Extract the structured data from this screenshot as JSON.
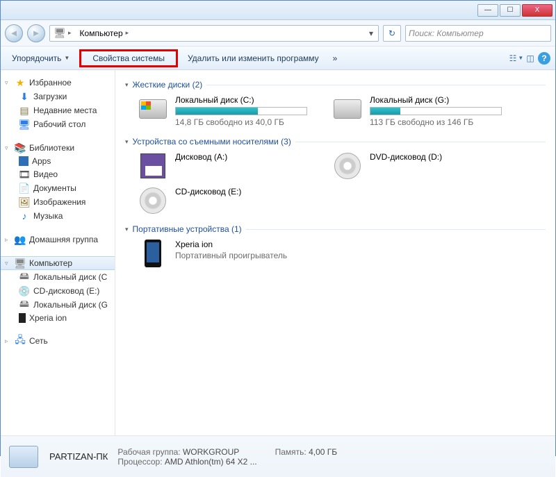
{
  "titlebar": {
    "min": "—",
    "max": "☐",
    "close": "X"
  },
  "nav": {
    "computer": "Компьютер",
    "search_placeholder": "Поиск: Компьютер"
  },
  "toolbar": {
    "organize": "Упорядочить",
    "sys_props": "Свойства системы",
    "uninstall": "Удалить или изменить программу",
    "more": "»"
  },
  "sidebar": {
    "favorites": {
      "head": "Избранное",
      "items": [
        "Загрузки",
        "Недавние места",
        "Рабочий стол"
      ]
    },
    "libraries": {
      "head": "Библиотеки",
      "items": [
        "Apps",
        "Видео",
        "Документы",
        "Изображения",
        "Музыка"
      ]
    },
    "homegroup": {
      "head": "Домашняя группа"
    },
    "computer": {
      "head": "Компьютер",
      "items": [
        "Локальный диск (C",
        "CD-дисковод (E:)",
        "Локальный диск (G",
        "Xperia ion"
      ]
    },
    "network": {
      "head": "Сеть"
    }
  },
  "categories": {
    "hdd": {
      "title": "Жесткие диски (2)"
    },
    "removable": {
      "title": "Устройства со съемными носителями (3)"
    },
    "portable": {
      "title": "Портативные устройства (1)"
    }
  },
  "drives": {
    "c": {
      "name": "Локальный диск (C:)",
      "free": "14,8 ГБ свободно из 40,0 ГБ",
      "fill": 63
    },
    "g": {
      "name": "Локальный диск (G:)",
      "free": "113 ГБ свободно из 146 ГБ",
      "fill": 23
    },
    "a": {
      "name": "Дисковод (A:)"
    },
    "d": {
      "name": "DVD-дисковод (D:)"
    },
    "e": {
      "name": "CD-дисковод (E:)"
    },
    "xperia": {
      "name": "Xperia ion",
      "sub": "Портативный проигрыватель"
    }
  },
  "details": {
    "name": "PARTIZAN-ПК",
    "workgroup_lbl": "Рабочая группа:",
    "workgroup": "WORKGROUP",
    "mem_lbl": "Память:",
    "mem": "4,00 ГБ",
    "cpu_lbl": "Процессор:",
    "cpu": "AMD Athlon(tm) 64 X2 ..."
  }
}
